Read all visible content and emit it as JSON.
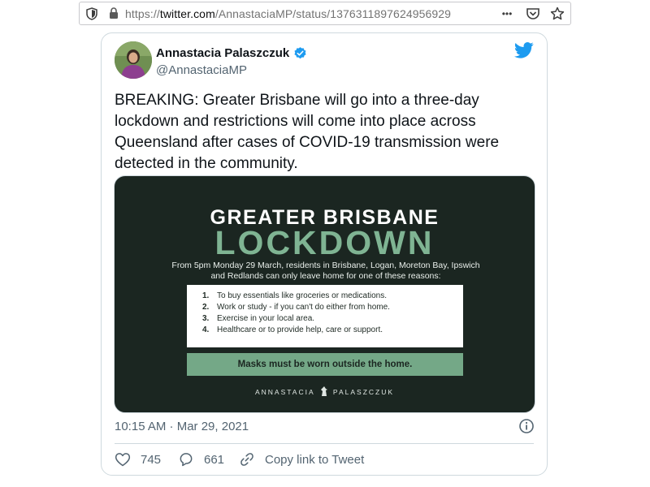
{
  "browser": {
    "url_prefix": "https://",
    "url_host": "twitter.com",
    "url_path": "/AnnastaciaMP/status/1376311897624956929",
    "menu_dots": "•••"
  },
  "tweet": {
    "author_name": "Annastacia Palaszczuk",
    "author_handle": "@AnnastaciaMP",
    "text": "BREAKING: Greater Brisbane will go into a three-day lockdown and restrictions will come into place across Queensland after cases of COVID-19 transmission were detected in the community.",
    "timestamp": "10:15 AM · Mar 29, 2021",
    "likes": "745",
    "replies": "661",
    "copy_link_label": "Copy link to Tweet"
  },
  "media": {
    "headline_top": "GREATER BRISBANE",
    "headline_main": "LOCKDOWN",
    "subtext": "From 5pm Monday 29 March, residents in Brisbane, Logan, Moreton Bay, Ipswich and Redlands can only leave home for one of these reasons:",
    "reasons": [
      {
        "num": "1.",
        "text": "To buy essentials like groceries or medications."
      },
      {
        "num": "2.",
        "text": "Work or study - if you can't do either from home."
      },
      {
        "num": "3.",
        "text": "Exercise in your local area."
      },
      {
        "num": "4.",
        "text": "Healthcare or to provide help, care or support."
      }
    ],
    "masks_notice": "Masks must be worn outside the home.",
    "signature_left": "ANNASTACIA",
    "signature_right": "PALASZCZUK"
  },
  "colors": {
    "twitter_blue": "#1d9bf0",
    "media_bg": "#1b2621",
    "lockdown_green": "#7fb493",
    "masks_bar": "#74a887"
  },
  "icons": [
    "shield-icon",
    "lock-icon",
    "pocket-icon",
    "star-icon",
    "verified-icon",
    "twitter-bird-icon",
    "info-icon",
    "heart-icon",
    "reply-icon",
    "link-icon"
  ]
}
